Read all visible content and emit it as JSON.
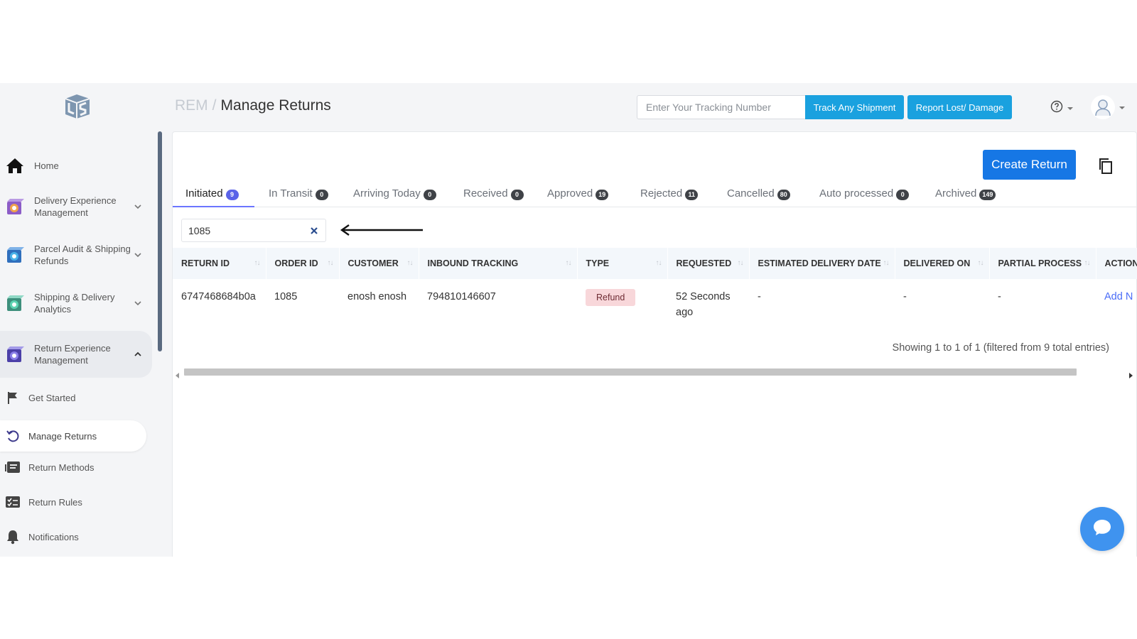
{
  "breadcrumb": {
    "root": "REM",
    "separator": "/",
    "current": "Manage Returns"
  },
  "header": {
    "tracking_placeholder": "Enter Your Tracking Number",
    "track_button": "Track Any Shipment",
    "report_button": "Report Lost/ Damage"
  },
  "sidebar": {
    "main_items": [
      {
        "label": "Home",
        "icon": "home-icon"
      },
      {
        "label": "Delivery Experience Management",
        "icon": "delivery-experience-icon"
      },
      {
        "label": "Parcel Audit & Shipping Refunds",
        "icon": "parcel-audit-icon"
      },
      {
        "label": "Shipping & Delivery Analytics",
        "icon": "analytics-icon"
      },
      {
        "label": "Return Experience Management",
        "icon": "return-experience-icon"
      }
    ],
    "sub_items": [
      {
        "label": "Get Started",
        "icon": "flag-icon"
      },
      {
        "label": "Manage Returns",
        "icon": "undo-icon"
      },
      {
        "label": "Return Methods",
        "icon": "return-methods-icon"
      },
      {
        "label": "Return Rules",
        "icon": "checklist-icon"
      },
      {
        "label": "Notifications",
        "icon": "bell-icon"
      }
    ]
  },
  "main": {
    "create_button": "Create Return",
    "tabs": [
      {
        "label": "Initiated",
        "count": "9"
      },
      {
        "label": "In Transit",
        "count": "0"
      },
      {
        "label": "Arriving Today",
        "count": "0"
      },
      {
        "label": "Received",
        "count": "0"
      },
      {
        "label": "Approved",
        "count": "19"
      },
      {
        "label": "Rejected",
        "count": "11"
      },
      {
        "label": "Cancelled",
        "count": "80"
      },
      {
        "label": "Auto processed",
        "count": "0"
      },
      {
        "label": "Archived",
        "count": "149"
      }
    ],
    "search_value": "1085",
    "table": {
      "columns": [
        "RETURN ID",
        "ORDER ID",
        "CUSTOMER",
        "INBOUND TRACKING",
        "TYPE",
        "REQUESTED",
        "ESTIMATED DELIVERY DATE",
        "DELIVERED ON",
        "PARTIAL PROCESS",
        "ACTION"
      ],
      "rows": [
        {
          "return_id": "6747468684b0a",
          "order_id": "1085",
          "customer": "enosh enosh",
          "inbound_tracking": "794810146607",
          "type": "Refund",
          "requested": "52 Seconds ago",
          "estimated_delivery": "-",
          "delivered_on": "-",
          "partial_process": "-",
          "action": "Add N"
        }
      ]
    },
    "info": "Showing 1 to 1 of 1 (filtered from 9 total entries)"
  },
  "colors": {
    "primary": "#1677e5",
    "header_button": "#1aa1df",
    "tab_active": "#5a63e8",
    "refund_bg": "#f8d7da"
  }
}
